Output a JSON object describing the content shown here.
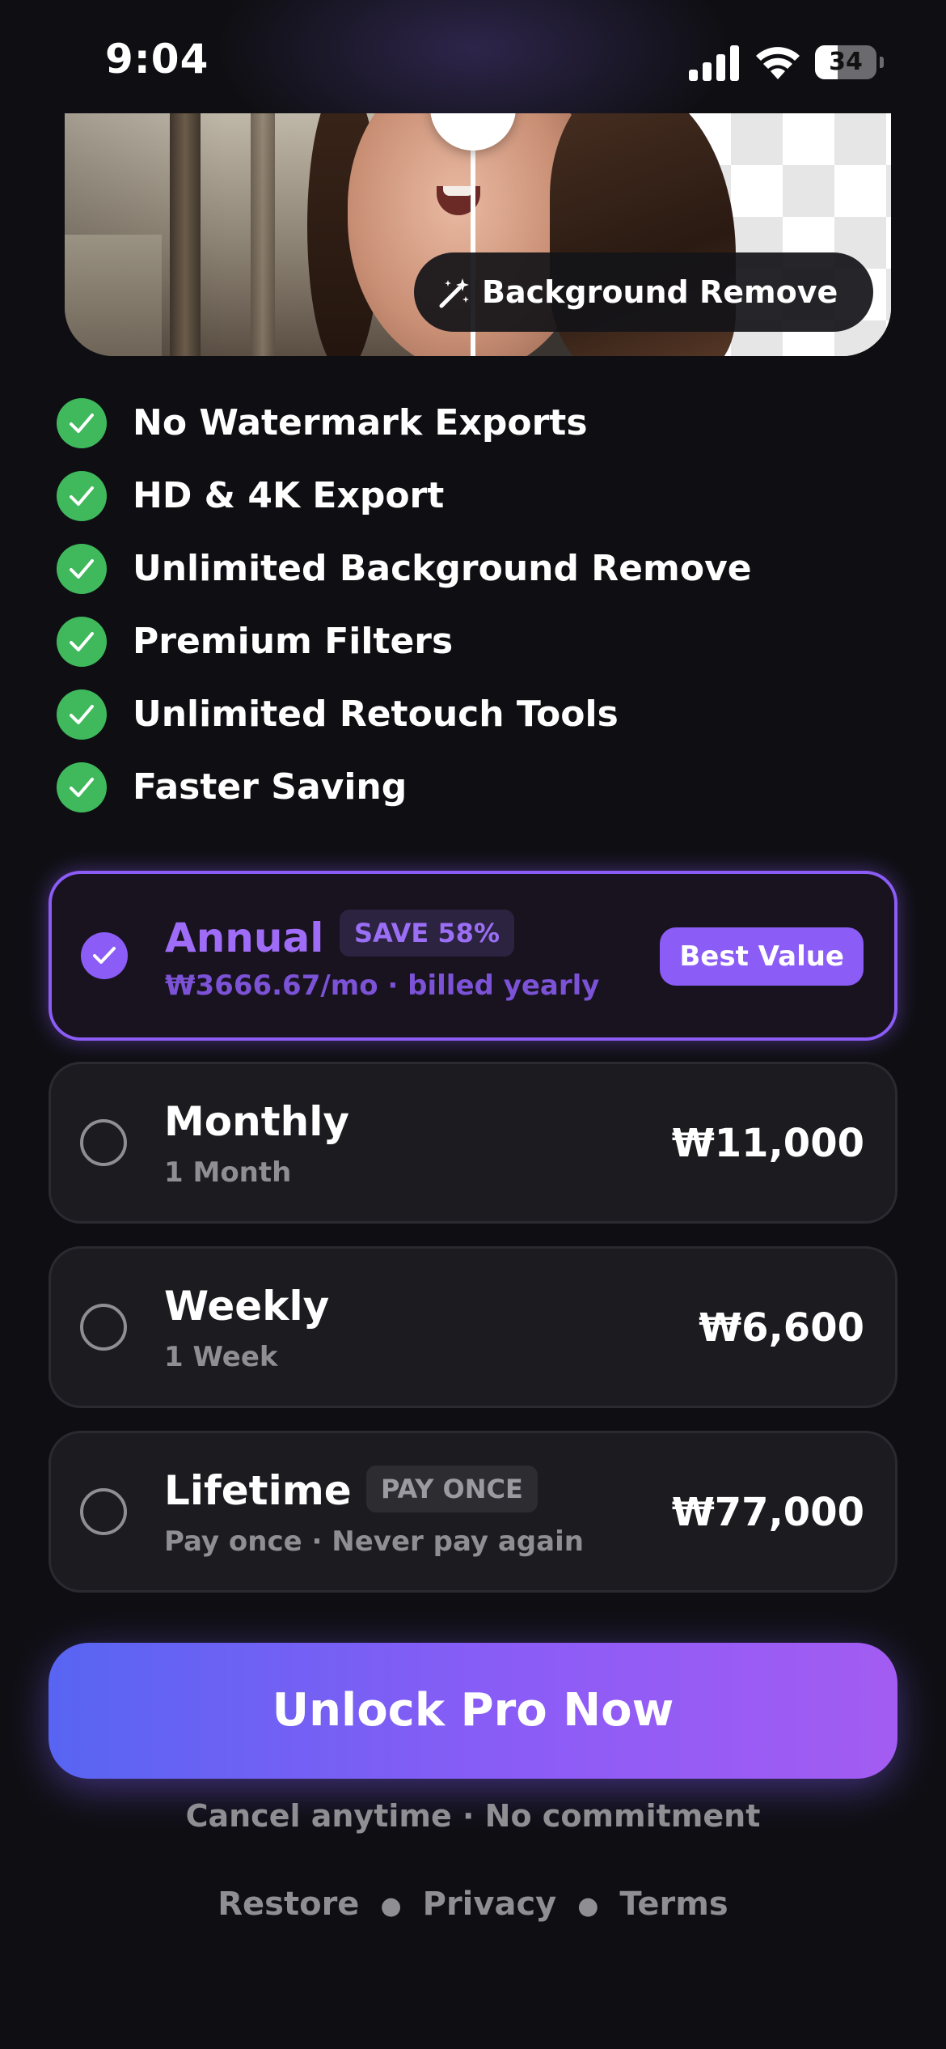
{
  "status_bar": {
    "time": "9:04",
    "battery": "34"
  },
  "hero": {
    "badge_label": "Background Remove",
    "badge_icon": "magic-wand-icon"
  },
  "features": [
    "No Watermark Exports",
    "HD & 4K Export",
    "Unlimited Background Remove",
    "Premium Filters",
    "Unlimited Retouch Tools",
    "Faster Saving"
  ],
  "plans": [
    {
      "title": "Annual",
      "tag": "SAVE 58%",
      "subtitle": "₩3666.67/mo · billed yearly",
      "badge": "Best Value",
      "selected": true
    },
    {
      "title": "Monthly",
      "subtitle": "1 Month",
      "price": "₩11,000",
      "selected": false
    },
    {
      "title": "Weekly",
      "subtitle": "1 Week",
      "price": "₩6,600",
      "selected": false
    },
    {
      "title": "Lifetime",
      "tag": "PAY ONCE",
      "subtitle": "Pay once · Never pay again",
      "price": "₩77,000",
      "selected": false
    }
  ],
  "cta": {
    "label": "Unlock Pro Now"
  },
  "note": "Cancel anytime · No commitment",
  "footer_links": [
    "Restore",
    "Privacy",
    "Terms"
  ],
  "colors": {
    "accent": "#8b5cf6",
    "check": "#3fb95c",
    "background": "#0f0f13"
  }
}
